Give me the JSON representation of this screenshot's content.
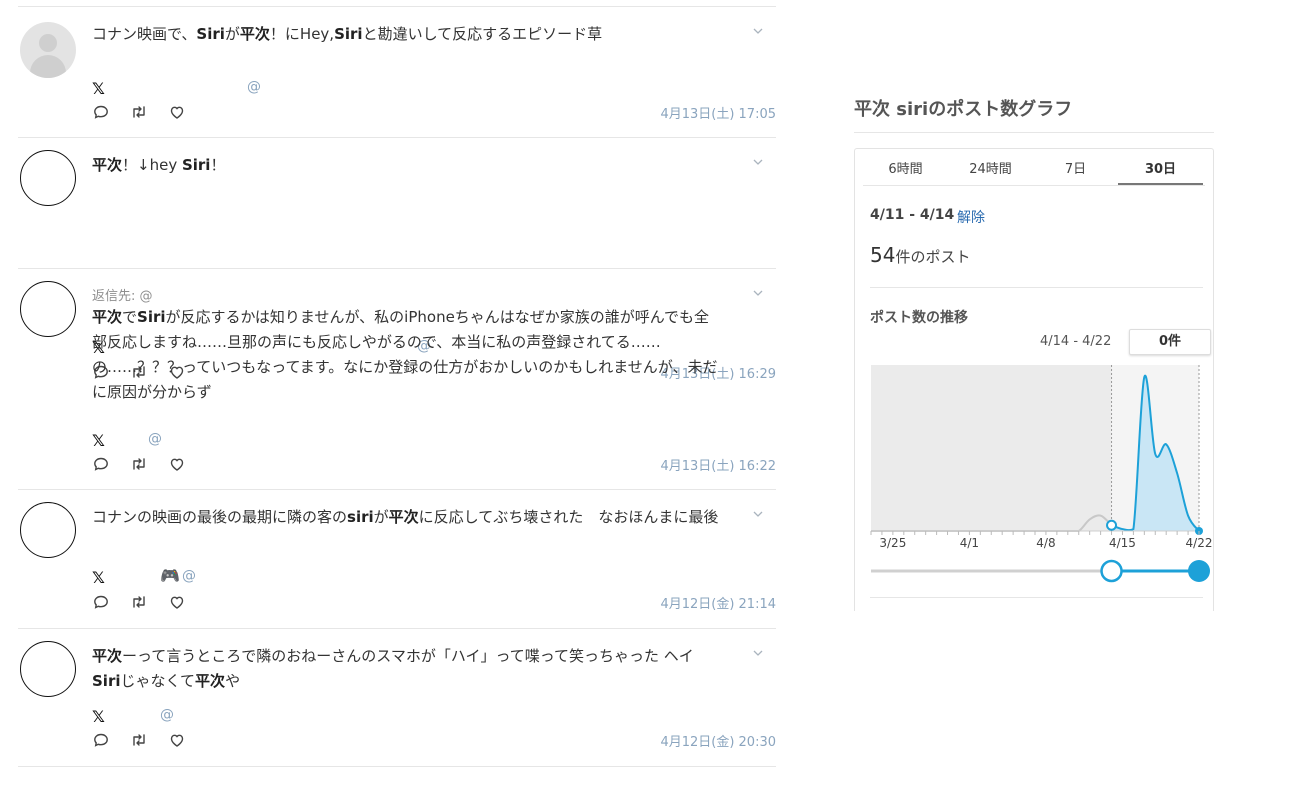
{
  "posts": [
    {
      "reply_to": "",
      "text_html": "コナン映画で、<b>Siri</b>が<b>平次</b>！にHey,<b>Siri</b>と勘違いして反応するエピソード草",
      "x_mark": "𝕏",
      "at": "@",
      "time": "4月13日(土) 17:05"
    },
    {
      "reply_to": "",
      "text_html": "<b>平次</b>！↓hey <b>Siri</b>！",
      "x_mark": "𝕏",
      "at": "@",
      "time": "4月13日(土) 16:29"
    },
    {
      "reply_to": "返信先: @",
      "text_html": "<b>平次</b>で<b>Siri</b>が反応するかは知りませんが、私のiPhoneちゃんはなぜか家族の誰が呼んでも全部反応しますね……旦那の声にも反応しやがるので、本当に私の声登録されてる……の……？？？っていつもなってます。なにか登録の仕方がおかしいのかもしれませんが、未だに原因が分からず",
      "x_mark": "𝕏",
      "at": "@",
      "time": "4月13日(土) 16:22"
    },
    {
      "reply_to": "",
      "text_html": "コナンの映画の最後の最期に隣の客の<b>siri</b>が<b>平次</b>に反応してぶち壊された　なおほんまに最後",
      "x_mark": "𝕏",
      "at": "@",
      "name_emoji": "🎮",
      "time": "4月12日(金) 21:14"
    },
    {
      "reply_to": "",
      "text_html": "<b>平次</b>ーって言うところで隣のおねーさんのスマホが「ハイ」って喋って笑っちゃった ヘイ<b>Siri</b>じゃなくて<b>平次</b>や",
      "x_mark": "𝕏",
      "at": "@",
      "time": "4月12日(金) 20:30"
    }
  ],
  "icons": {
    "reply": "reply-icon",
    "retweet": "retweet-icon",
    "like": "heart-icon",
    "menu": "chevron-down-icon"
  },
  "right": {
    "title": "平次 siriのポスト数グラフ",
    "tabs": [
      "6時間",
      "24時間",
      "7日",
      "30日"
    ],
    "active_tab": "30日",
    "range": "4/11 - 4/14",
    "clear": "解除",
    "count_num": "54",
    "count_suffix": "件のポスト",
    "subtitle": "ポスト数の推移",
    "selected_range": "4/14 - 4/22",
    "selected_count": "0件"
  },
  "colors": {
    "accent": "#1da1d8",
    "fill": "#c9e6f5",
    "link": "#2a6bb0",
    "time": "#8aa4be"
  },
  "chart_data": {
    "type": "area",
    "x_ticks": [
      "3/25",
      "4/1",
      "4/8",
      "4/15",
      "4/22"
    ],
    "x": [
      "3/23",
      "3/24",
      "3/25",
      "3/26",
      "3/27",
      "3/28",
      "3/29",
      "3/30",
      "3/31",
      "4/1",
      "4/2",
      "4/3",
      "4/4",
      "4/5",
      "4/6",
      "4/7",
      "4/8",
      "4/9",
      "4/10",
      "4/11",
      "4/12",
      "4/13",
      "4/14",
      "4/15",
      "4/16",
      "4/17",
      "4/18",
      "4/19",
      "4/20",
      "4/21",
      "4/22"
    ],
    "values": [
      0,
      0,
      0,
      0,
      0,
      0,
      0,
      0,
      0,
      0,
      0,
      0,
      0,
      0,
      0,
      0,
      0,
      0,
      0,
      0,
      6,
      8,
      3,
      1,
      1,
      80,
      40,
      45,
      30,
      8,
      0
    ],
    "selected_start": "4/14",
    "selected_end": "4/22",
    "grid": false
  }
}
